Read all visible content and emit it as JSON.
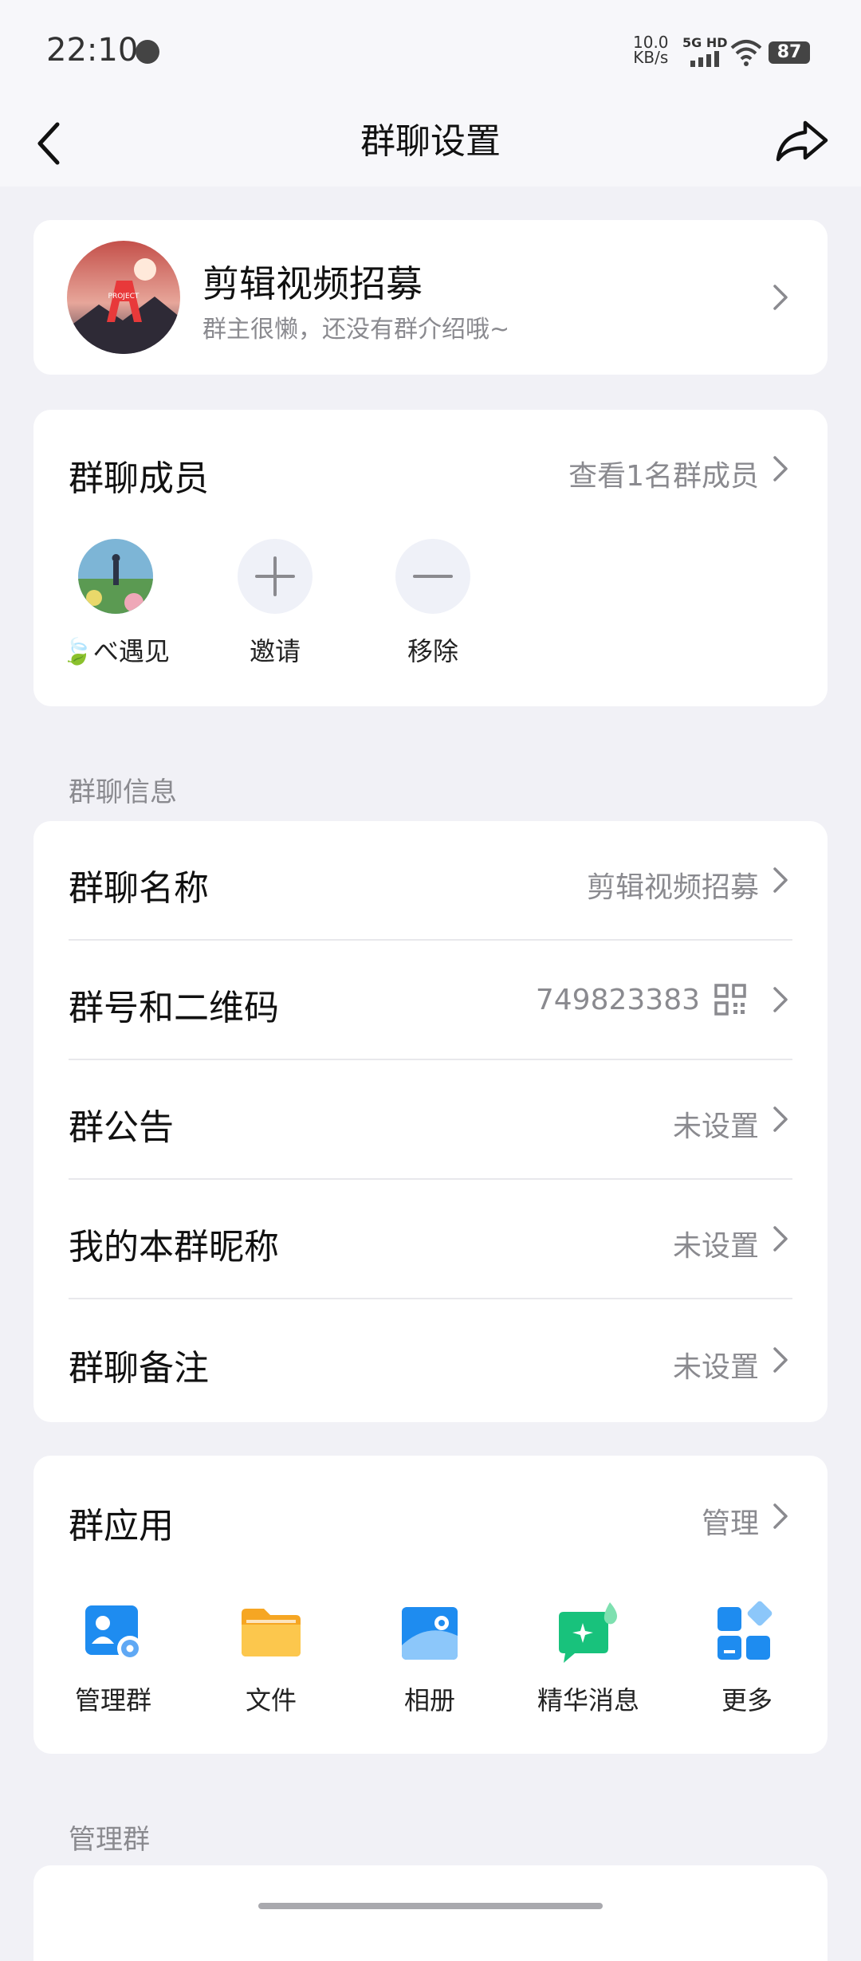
{
  "status_bar": {
    "time": "22:10",
    "net_speed_value": "10.0",
    "net_speed_unit": "KB/s",
    "network": "5G HD",
    "battery": "87"
  },
  "header": {
    "title": "群聊设置"
  },
  "group_profile": {
    "name": "剪辑视频招募",
    "description": "群主很懒，还没有群介绍哦~"
  },
  "members": {
    "title": "群聊成员",
    "view_all": "查看1名群成员",
    "items": [
      {
        "label": "🍃べ遇见"
      },
      {
        "label": "邀请"
      },
      {
        "label": "移除"
      }
    ]
  },
  "group_info": {
    "section_label": "群聊信息",
    "rows": [
      {
        "title": "群聊名称",
        "value": "剪辑视频招募"
      },
      {
        "title": "群号和二维码",
        "value": "749823383"
      },
      {
        "title": "群公告",
        "value": "未设置"
      },
      {
        "title": "我的本群昵称",
        "value": "未设置"
      },
      {
        "title": "群聊备注",
        "value": "未设置"
      }
    ]
  },
  "group_apps": {
    "title": "群应用",
    "manage_label": "管理",
    "apps": [
      {
        "label": "管理群",
        "icon": "manage-group-icon"
      },
      {
        "label": "文件",
        "icon": "folder-icon"
      },
      {
        "label": "相册",
        "icon": "album-icon"
      },
      {
        "label": "精华消息",
        "icon": "featured-message-icon"
      },
      {
        "label": "更多",
        "icon": "more-apps-icon"
      }
    ]
  },
  "manage_section": {
    "section_label": "管理群"
  },
  "colors": {
    "accent_blue": "#1E8CF0",
    "folder_yellow": "#F9B93B",
    "featured_green": "#18C27C",
    "background": "#F1F1F6"
  }
}
